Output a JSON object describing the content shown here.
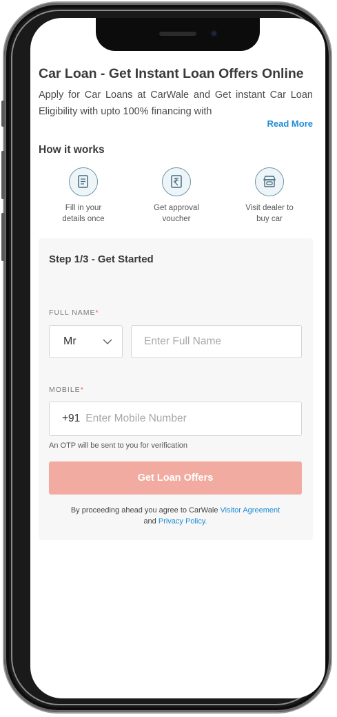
{
  "header": {
    "title": "Car Loan - Get Instant Loan Offers Online",
    "description": "Apply for Car Loans at CarWale and Get instant Car Loan Eligibility with upto 100% financing with",
    "read_more": "Read More"
  },
  "how_it_works": {
    "title": "How it works",
    "steps": [
      {
        "icon": "form-document-icon",
        "label_line1": "Fill in your",
        "label_line2": "details once"
      },
      {
        "icon": "rupee-voucher-icon",
        "label_line1": "Get approval",
        "label_line2": "voucher"
      },
      {
        "icon": "car-dealer-store-icon",
        "label_line1": "Visit dealer to",
        "label_line2": "buy car"
      }
    ]
  },
  "form": {
    "step_title": "Step 1/3 - Get Started",
    "full_name_label": "FULL NAME",
    "required_mark": "*",
    "salutation_value": "Mr",
    "full_name_placeholder": "Enter Full Name",
    "mobile_label": "MOBILE",
    "mobile_prefix": "+91",
    "mobile_placeholder": "Enter Mobile Number",
    "otp_note": "An OTP will be sent to you for verification",
    "submit_label": "Get Loan Offers",
    "agreement_prefix": "By proceeding ahead you agree to CarWale",
    "visitor_agreement_link": "Visitor Agreement",
    "agreement_and": "and",
    "privacy_policy_link": "Privacy Policy."
  },
  "colors": {
    "accent_link": "#1d8cd8",
    "cta_disabled": "#f2aba0",
    "required": "#e05a4a"
  }
}
